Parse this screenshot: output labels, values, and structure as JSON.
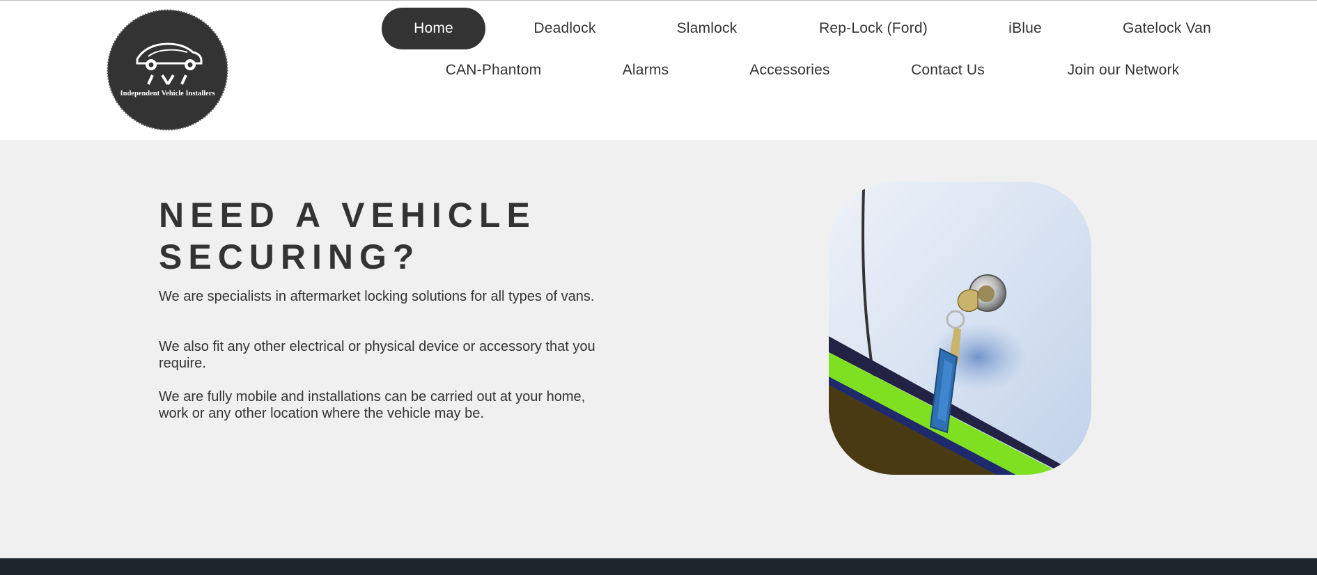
{
  "brand": {
    "logo_text": "Independent Vehicle Installers",
    "logo_colors": {
      "disc": "#333333",
      "mark": "#ffffff"
    }
  },
  "nav": {
    "items": [
      {
        "label": "Home",
        "active": true
      },
      {
        "label": "Deadlock"
      },
      {
        "label": "Slamlock"
      },
      {
        "label": "Rep-Lock (Ford)"
      },
      {
        "label": "iBlue"
      },
      {
        "label": "Gatelock Van"
      },
      {
        "label": "CAN-Phantom"
      },
      {
        "label": "Alarms"
      },
      {
        "label": "Accessories"
      },
      {
        "label": "Contact Us"
      },
      {
        "label": "Join our Network"
      }
    ]
  },
  "hero": {
    "title_line1": "NEED A VEHICLE",
    "title_line2": "SECURING?",
    "paragraphs": [
      "We are specialists in aftermarket locking solutions for all types of vans.",
      "We also fit any other electrical or physical device or accessory that you require.",
      "We are fully mobile and installations can be carried out at your home, work or any other location where the vehicle may be."
    ]
  },
  "colors": {
    "header_bg": "#ffffff",
    "hero_bg": "#f0f0f0",
    "text": "#333333",
    "active_nav_bg": "#333333",
    "footer_bg": "#1e252c"
  }
}
